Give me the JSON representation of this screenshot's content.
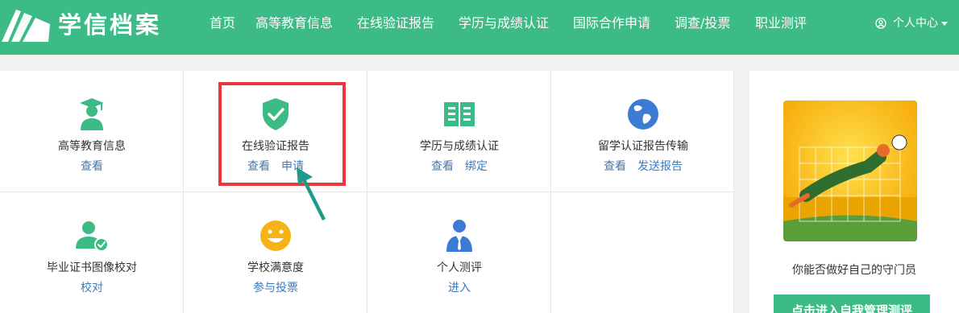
{
  "header": {
    "brand": "学信档案",
    "nav": [
      "首页",
      "高等教育信息",
      "在线验证报告",
      "学历与成绩认证",
      "国际合作申请",
      "调查/投票",
      "职业测评"
    ],
    "user_center": "个人中心",
    "bg_color": "#3dbb87"
  },
  "services": [
    {
      "title": "高等教育信息",
      "icon": "graduate-icon",
      "actions": [
        "查看"
      ]
    },
    {
      "title": "在线验证报告",
      "icon": "shield-check-icon",
      "actions": [
        "查看",
        "申请"
      ]
    },
    {
      "title": "学历与成绩认证",
      "icon": "book-icon",
      "actions": [
        "查看",
        "绑定"
      ]
    },
    {
      "title": "留学认证报告传输",
      "icon": "globe-icon",
      "actions": [
        "查看",
        "发送报告"
      ]
    },
    {
      "title": "毕业证书图像校对",
      "icon": "user-check-icon",
      "actions": [
        "校对"
      ]
    },
    {
      "title": "学校满意度",
      "icon": "smiley-icon",
      "actions": [
        "参与投票"
      ]
    },
    {
      "title": "个人测评",
      "icon": "person-tie-icon",
      "actions": [
        "进入"
      ]
    }
  ],
  "highlight": {
    "color": "#e8383d",
    "arrow_color": "#1e9a8a"
  },
  "promo": {
    "text": "你能否做好自己的守门员",
    "button": "点击进入自我管理测评"
  },
  "colors": {
    "link": "#3b7bbf",
    "accent": "#3dbb87"
  }
}
